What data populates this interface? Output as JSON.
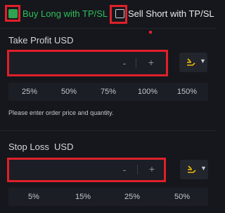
{
  "buy_long": {
    "label": "Buy Long with TP/SL",
    "checked": true
  },
  "sell_short": {
    "label": "Sell Short with TP/SL",
    "checked": false
  },
  "take_profit": {
    "title": "Take Profit USD",
    "value": "",
    "minus": "-",
    "plus": "+",
    "percents": [
      "25%",
      "50%",
      "75%",
      "100%",
      "150%"
    ]
  },
  "hint": "Please enter order price and quantity.",
  "stop_loss": {
    "title": "Stop Loss  USD",
    "value": "",
    "minus": "-",
    "plus": "+",
    "percents": [
      "5%",
      "15%",
      "25%",
      "50%"
    ]
  },
  "icons": {
    "checkbox_on": "checkbox-checked-icon",
    "checkbox_off": "checkbox-unchecked-icon",
    "mode": "trend-lines-icon",
    "caret": "caret-down-icon"
  },
  "colors": {
    "accent_green": "#2fbf5b",
    "highlight_red": "#e0202a",
    "mode_icon": "#f0b90b"
  }
}
